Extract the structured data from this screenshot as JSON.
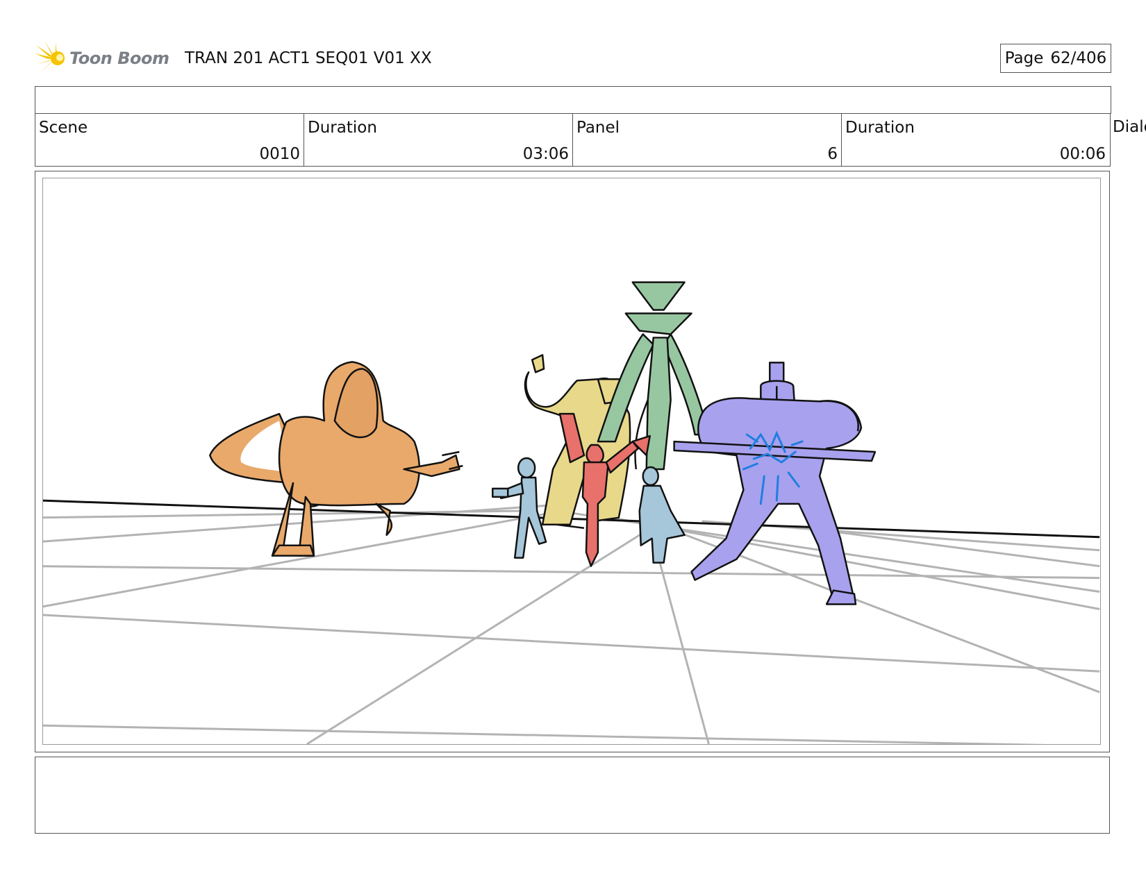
{
  "header": {
    "logo_text": "Toon Boom",
    "title": "TRAN 201 ACT1 SEQ01 V01 XX",
    "page_label": "Page",
    "page_value": "62/406"
  },
  "info": {
    "scene_label": "Scene",
    "scene_value": "0010",
    "scene_duration_label": "Duration",
    "scene_duration_value": "03:06",
    "panel_label": "Panel",
    "panel_value": "6",
    "panel_duration_label": "Duration",
    "panel_duration_value": "00:06",
    "dialog_label": "Dialo"
  },
  "icons": {
    "logo": "sunburst-logo-icon"
  },
  "colors": {
    "logo_yellow": "#f5c400",
    "orange_character": "#e8a96b",
    "yellow_character": "#e8d88a",
    "green_character": "#97c7a1",
    "red_character": "#e8716b",
    "blue_character": "#a6c6d9",
    "purple_character": "#a8a1ee",
    "energy_blue": "#1f7fe0"
  }
}
